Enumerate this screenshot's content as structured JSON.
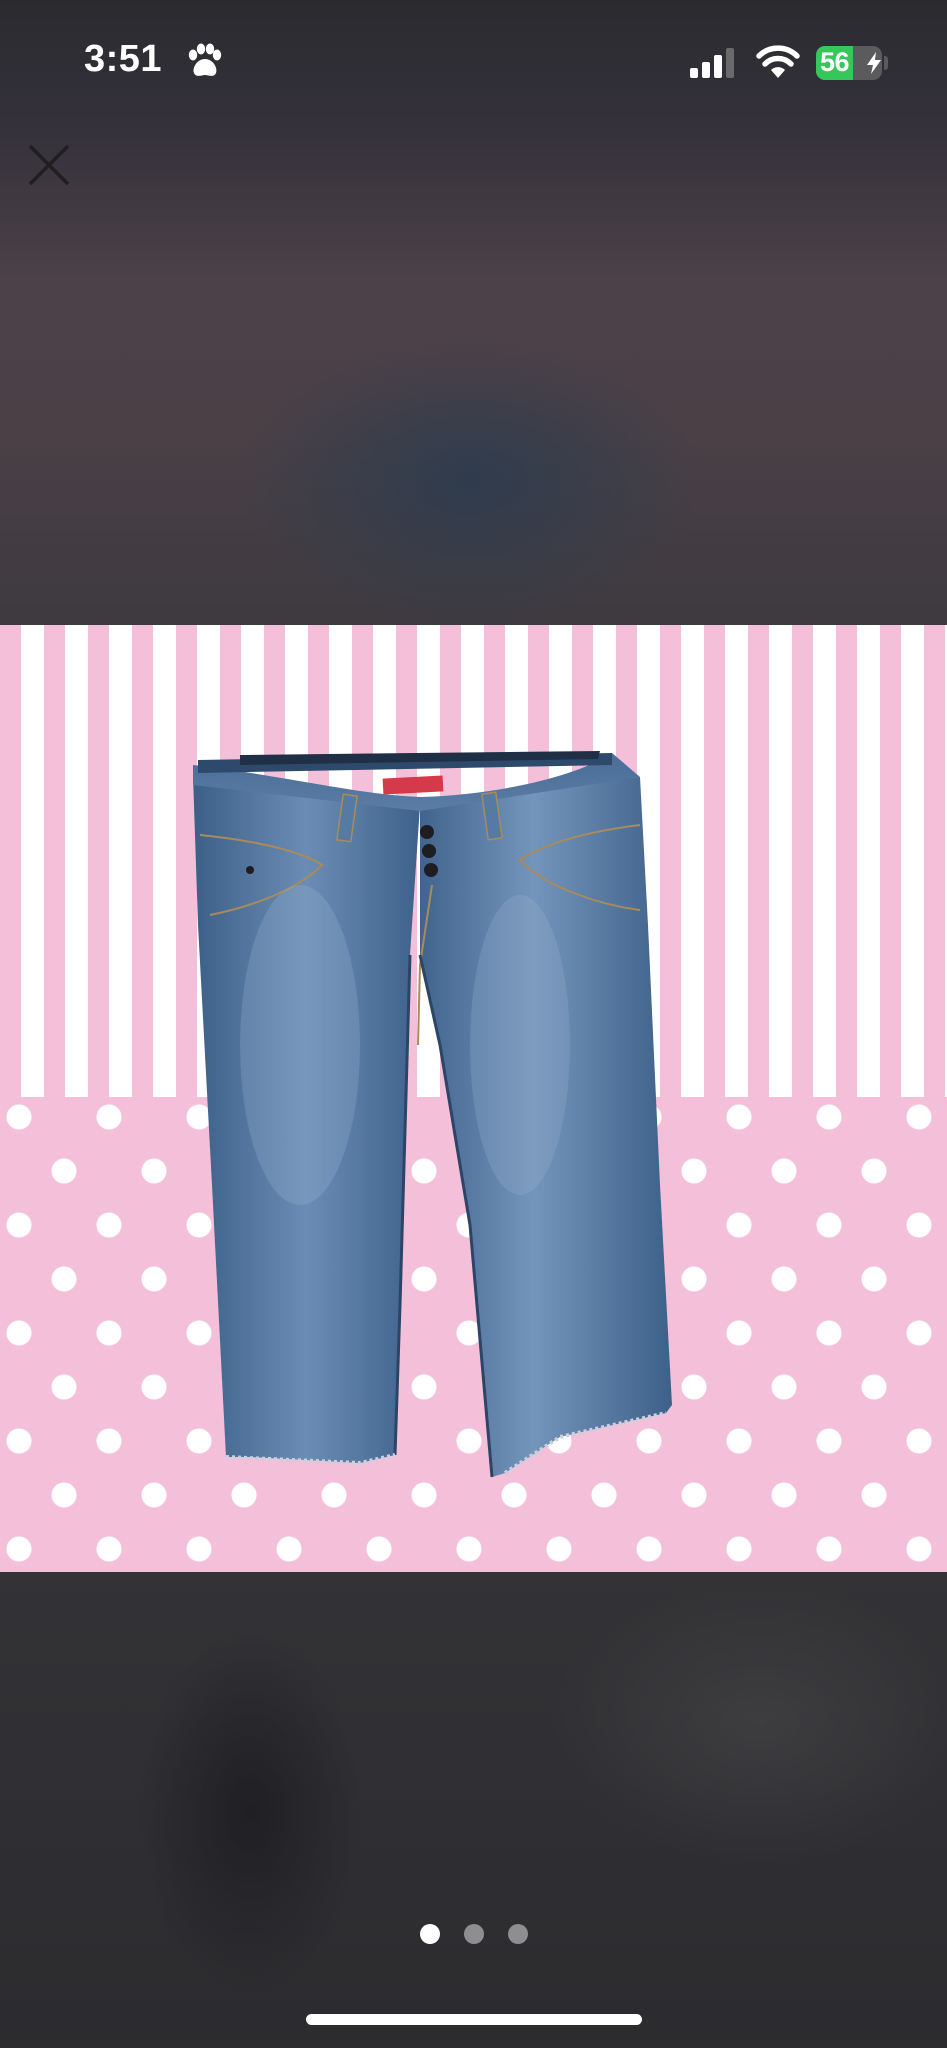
{
  "status_bar": {
    "time": "3:51",
    "battery_level": "56",
    "battery_fraction": 0.56,
    "icons": [
      "paw-icon",
      "cellular-signal-icon",
      "wifi-icon",
      "battery-icon",
      "charging-bolt-icon"
    ]
  },
  "viewer": {
    "close_icon": "close-icon",
    "image_count": 3,
    "active_index": 0
  },
  "product_image": {
    "background_colors": {
      "pink": "#f4bfd9",
      "white": "#ffffff"
    },
    "denim_color": "#4a6f99",
    "label_color": "#d43a4a"
  }
}
